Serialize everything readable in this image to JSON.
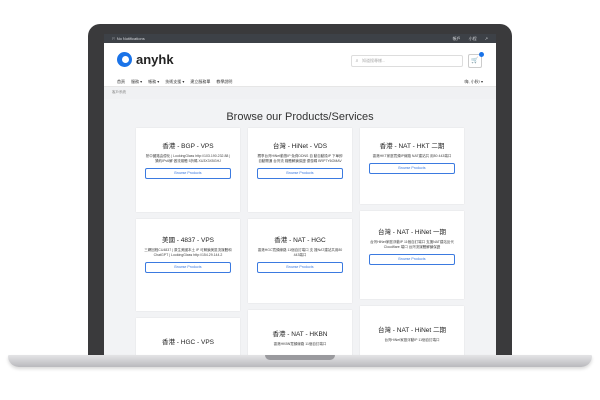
{
  "topbar": {
    "notifications": "No Notifications",
    "user_menu": "帳戶",
    "lang_menu": "小程"
  },
  "header": {
    "brand": "anyhk",
    "search_placeholder": "知道搜尋樣..."
  },
  "nav": {
    "items": [
      "首頁",
      "服務 ▾",
      "帳務 ▾",
      "技術支援 ▾",
      "建立服務單",
      "教學說明"
    ],
    "account": "嗨, 小秋! ▾"
  },
  "breadcrumb": "客戶系統",
  "page_title": "Browse our Products/Services",
  "products": [
    {
      "name": "香港 - BGP - VPS",
      "desc": "熱中國路由優化 | LookingGlass http://103.190.232.88 | 猜約IPv6解 做流媒體 5折碼 XU3X3X5GHJ",
      "button": "Browse Products"
    },
    {
      "name": "台灣 - HiNet - VDS",
      "desc": "獨享台灣HiNet動態IP 免費DDNS 自 動自動換IP 下單即自動開通 台灣流 媒體解鎖保證 優惠碼 BRP7Y6OMAV",
      "button": "Browse Products"
    },
    {
      "name": "香港 - NAT - HKT 二期",
      "desc": "香港HKT家庭寬頻IP線路 NAT建站共 用80 443端口",
      "button": "Browse Products"
    },
    {
      "name": "美國 - 4837 - VPS",
      "desc": "三網回程CU4837 | 原生美國本土 IP 可解鎖美區流媒體和 ChatGPT | LookingGlass http://154.29.144.2",
      "button": "Browse Products"
    },
    {
      "name": "香港 - NAT - HGC",
      "desc": "香港HGC寬頻線路 11個自訂端口 支 援NAT建站共用80 443端口",
      "button": "Browse Products"
    },
    {
      "name": "台灣 - NAT - HiNet 一期",
      "desc": "台灣HiNet家庭浮動IP 11個自訂端口 支援NAT建站反代Cloudflare 端口 台灣流媒體解鎖保證",
      "button": "Browse Products"
    },
    {
      "name": "香港 - HGC - VPS",
      "desc": "",
      "button": ""
    },
    {
      "name": "香港 - NAT - HKBN",
      "desc": "香港HKBN寬頻線路 11個自訂端口",
      "button": ""
    },
    {
      "name": "台灣 - NAT - HiNet 二期",
      "desc": "台灣HiNet家庭浮動IP 11個自訂端口",
      "button": ""
    }
  ]
}
